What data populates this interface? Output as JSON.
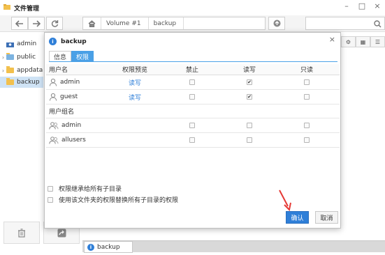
{
  "window": {
    "title": "文件管理",
    "minimize": "–",
    "maximize": "□",
    "close": "×"
  },
  "toolbar": {
    "back_icon": "arrow-left-icon",
    "forward_icon": "arrow-right-icon",
    "refresh_icon": "refresh-icon",
    "home_icon": "home-icon",
    "breadcrumb": [
      "Volume #1",
      "backup"
    ],
    "upload_icon": "up-arrow-circle-icon",
    "search_icon": "search-icon"
  },
  "sidebar": {
    "items": [
      {
        "label": "admin",
        "type": "user",
        "active": false
      },
      {
        "label": "public",
        "type": "folder",
        "active": false
      },
      {
        "label": "appdata",
        "type": "folder",
        "active": false
      },
      {
        "label": "backup",
        "type": "folder",
        "active": true
      }
    ]
  },
  "dialog": {
    "title": "backup",
    "close": "×",
    "tabs": [
      {
        "label": "信息",
        "active": false
      },
      {
        "label": "权限",
        "active": true
      }
    ],
    "columns": [
      "用户名",
      "权限预览",
      "禁止",
      "读写",
      "只读"
    ],
    "users": [
      {
        "name": "admin",
        "preview": "读写",
        "deny": false,
        "rw": true,
        "ro": false
      },
      {
        "name": "guest",
        "preview": "读写",
        "deny": false,
        "rw": true,
        "ro": false
      }
    ],
    "group_header": "用户组名",
    "groups": [
      {
        "name": "admin",
        "preview": "",
        "deny": false,
        "rw": false,
        "ro": false
      },
      {
        "name": "allusers",
        "preview": "",
        "deny": false,
        "rw": false,
        "ro": false
      }
    ],
    "options": [
      {
        "label": "权限继承给所有子目录",
        "checked": false
      },
      {
        "label": "使用该文件夹的权限替换所有子目录的权限",
        "checked": false
      }
    ],
    "ok_label": "确认",
    "cancel_label": "取消"
  },
  "taskbar": {
    "item_label": "backup"
  },
  "colors": {
    "accent": "#2f7fd8",
    "tab_active": "#4aa0e6",
    "annotation_arrow": "#e53935"
  }
}
